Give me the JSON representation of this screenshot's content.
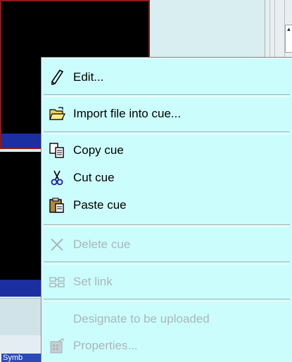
{
  "background": {
    "tab_label": "Symb"
  },
  "context_menu": {
    "items": [
      {
        "label": "Edit...",
        "icon": "pencil-icon",
        "enabled": true
      },
      {
        "label": "Import file into cue...",
        "icon": "open-folder-icon",
        "enabled": true
      },
      {
        "label": "Copy cue",
        "icon": "copy-icon",
        "enabled": true
      },
      {
        "label": "Cut cue",
        "icon": "scissors-icon",
        "enabled": true
      },
      {
        "label": "Paste cue",
        "icon": "paste-icon",
        "enabled": true
      },
      {
        "label": "Delete cue",
        "icon": "delete-x-icon",
        "enabled": false
      },
      {
        "label": "Set link",
        "icon": "link-icon",
        "enabled": false
      },
      {
        "label": "Designate to be uploaded",
        "icon": "",
        "enabled": false
      },
      {
        "label": "Properties...",
        "icon": "properties-icon",
        "enabled": false
      }
    ]
  },
  "colors": {
    "menu_background": "#ccfdfd",
    "disabled_text": "#a8b7b9",
    "tile_bar": "#1c2fa0",
    "selected_border": "#8b1a1a"
  }
}
